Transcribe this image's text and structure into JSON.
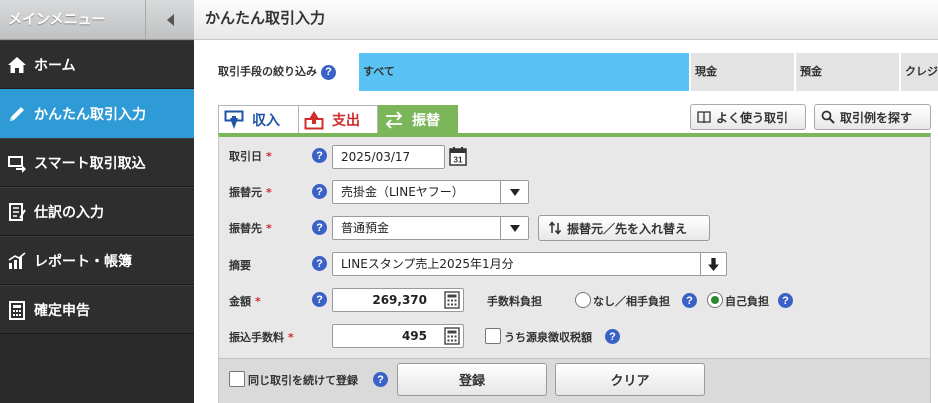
{
  "sidebar": {
    "header": "メインメニュー",
    "items": [
      {
        "label": "ホーム",
        "icon": "home-icon"
      },
      {
        "label": "かんたん取引入力",
        "icon": "pencil-icon",
        "active": true
      },
      {
        "label": "スマート取引取込",
        "icon": "import-icon"
      },
      {
        "label": "仕訳の入力",
        "icon": "journal-icon"
      },
      {
        "label": "レポート・帳簿",
        "icon": "chart-icon"
      },
      {
        "label": "確定申告",
        "icon": "calculator-icon"
      }
    ]
  },
  "header": {
    "title": "かんたん取引入力"
  },
  "filter": {
    "label": "取引手段の絞り込み",
    "tabs": [
      "すべて",
      "現金",
      "預金",
      "クレジ"
    ],
    "selected": "すべて",
    "accent": "#5bc2f6"
  },
  "tabs": {
    "income": "収入",
    "expense": "支出",
    "transfer": "振替",
    "active": "振替",
    "active_color": "#7cb65a"
  },
  "toolbar": {
    "favorites": "よく使う取引",
    "examples": "取引例を探す"
  },
  "form": {
    "date_label": "取引日",
    "date_value": "2025/03/17",
    "from_label": "振替元",
    "from_value": "売掛金（LINEヤフー）",
    "to_label": "振替先",
    "to_value": "普通預金",
    "swap_label": "振替元／先を入れ替え",
    "memo_label": "摘要",
    "memo_value": "LINEスタンプ売上2025年1月分",
    "amount_label": "金額",
    "amount_value": "269,370",
    "fee_burden_label": "手数料負担",
    "fee_option_none": "なし／相手負担",
    "fee_option_self": "自己負担",
    "fee_label": "振込手数料",
    "fee_value": "495",
    "withholding_label": "うち源泉徴収税額",
    "required_mark": "*",
    "help_mark": "?",
    "calendar_day": "31"
  },
  "footer": {
    "continue_label": "同じ取引を続けて登録",
    "register": "登録",
    "clear": "クリア"
  }
}
